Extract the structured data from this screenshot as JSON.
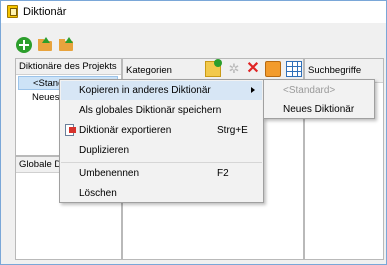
{
  "window": {
    "title": "Diktionär"
  },
  "toolbar": {
    "icons": [
      "add-circle-icon",
      "folder-up-icon",
      "folder-import-icon"
    ]
  },
  "panels": {
    "project": {
      "header": "Diktionäre des Projekts",
      "items": [
        "<Standard>",
        "Neues"
      ]
    },
    "global": {
      "header": "Globale Di"
    },
    "categories": {
      "header": "Kategorien",
      "tool_icons": [
        "new-folder-icon",
        "disabled-gear-icon",
        "delete-icon",
        "image-icon",
        "grid-icon"
      ]
    },
    "search_terms": {
      "header": "Suchbegriffe"
    }
  },
  "context_menu": {
    "items": [
      {
        "label": "Kopieren in anderes Diktionär",
        "has_submenu": true
      },
      {
        "label": "Als globales Diktionär speichern"
      },
      {
        "label": "Diktionär exportieren",
        "shortcut": "Strg+E",
        "icon": "export-icon"
      },
      {
        "label": "Duplizieren"
      },
      {
        "label": "Umbenennen",
        "shortcut": "F2"
      },
      {
        "label": "Löschen"
      }
    ]
  },
  "submenu": {
    "items": [
      {
        "label": "<Standard>",
        "disabled": true
      },
      {
        "label": "Neues Diktionär"
      }
    ]
  }
}
